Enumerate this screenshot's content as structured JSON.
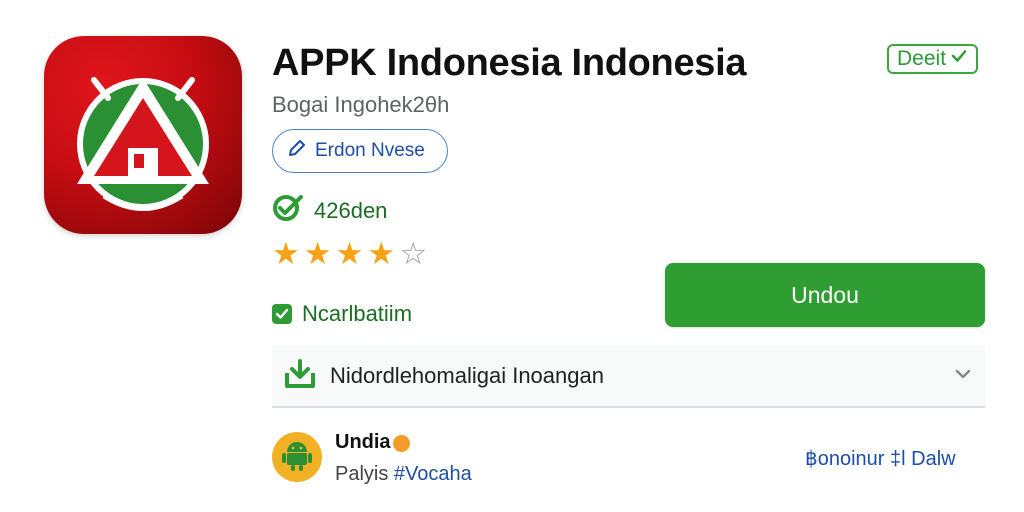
{
  "app": {
    "title": "APPK Indonesia  Indonesia",
    "subtitle": "Bogai Ingohek2θh",
    "icon": "app-logo-android-tent-icon",
    "verified_label": "Deeit"
  },
  "edit_chip": {
    "label": "Erdon Nvese",
    "icon": "pencil-icon"
  },
  "rating": {
    "count_label": "426den",
    "stars": 4,
    "max_stars": 5,
    "icon": "check-badge-icon"
  },
  "checkbox": {
    "label": "Ncarlbatiim",
    "checked": true
  },
  "install": {
    "label": "Undou"
  },
  "expand": {
    "label": "Nidordlehomaligai Inoangan",
    "icon": "download-tray-icon",
    "chevron": "chevron-down-icon"
  },
  "developer": {
    "name": "Undia",
    "sub_prefix": "Palyis ",
    "sub_tag": "#Vocaha",
    "link": "฿onoinur ‡l Dalw",
    "avatar_icon": "android-robot-icon"
  },
  "colors": {
    "brand_red": "#c50d12",
    "accent_green": "#2f9e32",
    "link_blue": "#1d4ea8",
    "star_gold": "#f4a316"
  }
}
